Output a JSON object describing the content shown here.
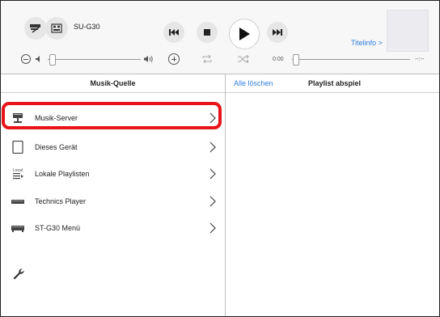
{
  "header": {
    "device_name": "SU-G30",
    "titelinfo_label": "Titelinfo >",
    "time_elapsed": "0:00",
    "time_remaining": "--:--"
  },
  "source_panel": {
    "title": "Musik-Quelle",
    "items": [
      {
        "label": "Musik-Server",
        "icon": "music-server-icon",
        "highlighted": true
      },
      {
        "label": "Dieses Gerät",
        "icon": "tablet-icon"
      },
      {
        "label": "Lokale Playlisten",
        "icon": "local-playlist-icon",
        "icon_text": "Local"
      },
      {
        "label": "Technics Player",
        "icon": "player-device-icon"
      },
      {
        "label": "ST-G30 Menü",
        "icon": "st-g30-device-icon"
      }
    ]
  },
  "playlist_panel": {
    "clear_all_label": "Alle löschen",
    "title": "Playlist abspiel"
  },
  "colors": {
    "accent_blue": "#2f7fe0",
    "highlight_red": "#e8141a"
  }
}
